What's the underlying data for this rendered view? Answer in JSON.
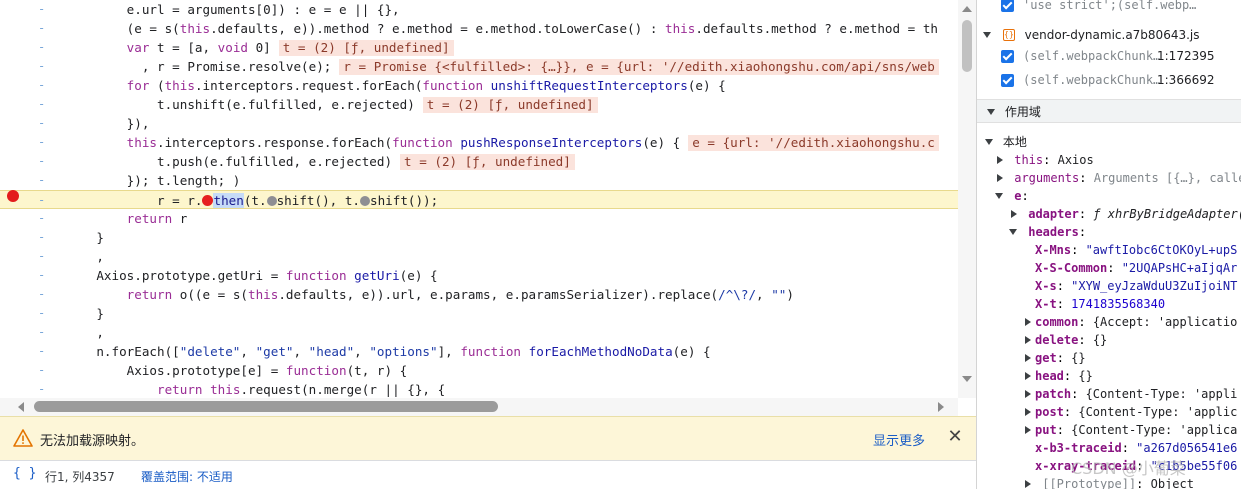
{
  "editor": {
    "lines": [
      {
        "segments": [
          {
            "t": "        e.url = arguments[0]) : e = e || {},",
            "c": ""
          }
        ]
      },
      {
        "segments": [
          {
            "t": "        (e = s(",
            "c": ""
          },
          {
            "t": "this",
            "c": "kw"
          },
          {
            "t": ".defaults, e)).method ? e.method = e.method.toLowerCase() : ",
            "c": ""
          },
          {
            "t": "this",
            "c": "kw"
          },
          {
            "t": ".defaults.method ? e.method = th",
            "c": ""
          }
        ]
      },
      {
        "segments": [
          {
            "t": "        ",
            "c": ""
          },
          {
            "t": "var",
            "c": "kw"
          },
          {
            "t": " t = [a, ",
            "c": ""
          },
          {
            "t": "void",
            "c": "kw"
          },
          {
            "t": " 0]",
            "c": ""
          }
        ],
        "value": "t = (2) [ƒ, undefined]"
      },
      {
        "segments": [
          {
            "t": "          , r = Promise.resolve(e);",
            "c": ""
          }
        ],
        "value": "r = Promise {<fulfilled>: {…}}, e = {url: '//edith.xiaohongshu.com/api/sns/web"
      },
      {
        "segments": [
          {
            "t": "        ",
            "c": ""
          },
          {
            "t": "for",
            "c": "kw"
          },
          {
            "t": " (",
            "c": ""
          },
          {
            "t": "this",
            "c": "kw"
          },
          {
            "t": ".interceptors.request.forEach(",
            "c": ""
          },
          {
            "t": "function",
            "c": "kw"
          },
          {
            "t": " ",
            "c": ""
          },
          {
            "t": "unshiftRequestInterceptors",
            "c": "fn"
          },
          {
            "t": "(e) {",
            "c": ""
          }
        ]
      },
      {
        "segments": [
          {
            "t": "            t.unshift(e.fulfilled, e.rejected)",
            "c": ""
          }
        ],
        "value": "t = (2) [ƒ, undefined]"
      },
      {
        "segments": [
          {
            "t": "        }),",
            "c": ""
          }
        ]
      },
      {
        "segments": [
          {
            "t": "        ",
            "c": ""
          },
          {
            "t": "this",
            "c": "kw"
          },
          {
            "t": ".interceptors.response.forEach(",
            "c": ""
          },
          {
            "t": "function",
            "c": "kw"
          },
          {
            "t": " ",
            "c": ""
          },
          {
            "t": "pushResponseInterceptors",
            "c": "fn"
          },
          {
            "t": "(e) {",
            "c": ""
          }
        ],
        "value": "e = {url: '//edith.xiaohongshu.c"
      },
      {
        "segments": [
          {
            "t": "            t.push(e.fulfilled, e.rejected)",
            "c": ""
          }
        ],
        "value": "t = (2) [ƒ, undefined]"
      },
      {
        "segments": [
          {
            "t": "        }); t.length; )",
            "c": ""
          }
        ]
      },
      {
        "highlight": true,
        "segments": [
          {
            "t": "            r = r.",
            "c": ""
          },
          {
            "t": "@bp",
            "c": "bp"
          },
          {
            "t": "then",
            "c": "sel"
          },
          {
            "t": "(t.",
            "c": ""
          },
          {
            "t": "@step",
            "c": "step"
          },
          {
            "t": "shift(), t.",
            "c": ""
          },
          {
            "t": "@step",
            "c": "step"
          },
          {
            "t": "shift());",
            "c": ""
          }
        ]
      },
      {
        "segments": [
          {
            "t": "        ",
            "c": ""
          },
          {
            "t": "return",
            "c": "kw"
          },
          {
            "t": " r",
            "c": ""
          }
        ]
      },
      {
        "segments": [
          {
            "t": "    }",
            "c": ""
          }
        ]
      },
      {
        "segments": [
          {
            "t": "    ,",
            "c": ""
          }
        ]
      },
      {
        "segments": [
          {
            "t": "    Axios.prototype.getUri = ",
            "c": ""
          },
          {
            "t": "function",
            "c": "kw"
          },
          {
            "t": " ",
            "c": ""
          },
          {
            "t": "getUri",
            "c": "fn"
          },
          {
            "t": "(e) {",
            "c": ""
          }
        ]
      },
      {
        "segments": [
          {
            "t": "        ",
            "c": ""
          },
          {
            "t": "return",
            "c": "kw"
          },
          {
            "t": " o((e = s(",
            "c": ""
          },
          {
            "t": "this",
            "c": "kw"
          },
          {
            "t": ".defaults, e)).url, e.params, e.paramsSerializer).replace(",
            "c": ""
          },
          {
            "t": "/^\\?/",
            "c": "str"
          },
          {
            "t": ", ",
            "c": ""
          },
          {
            "t": "\"\"",
            "c": "str"
          },
          {
            "t": ")",
            "c": ""
          }
        ]
      },
      {
        "segments": [
          {
            "t": "    }",
            "c": ""
          }
        ]
      },
      {
        "segments": [
          {
            "t": "    ,",
            "c": ""
          }
        ]
      },
      {
        "segments": [
          {
            "t": "    n.forEach([",
            "c": ""
          },
          {
            "t": "\"delete\"",
            "c": "str"
          },
          {
            "t": ", ",
            "c": ""
          },
          {
            "t": "\"get\"",
            "c": "str"
          },
          {
            "t": ", ",
            "c": ""
          },
          {
            "t": "\"head\"",
            "c": "str"
          },
          {
            "t": ", ",
            "c": ""
          },
          {
            "t": "\"options\"",
            "c": "str"
          },
          {
            "t": "], ",
            "c": ""
          },
          {
            "t": "function",
            "c": "kw"
          },
          {
            "t": " ",
            "c": ""
          },
          {
            "t": "forEachMethodNoData",
            "c": "fn"
          },
          {
            "t": "(e) {",
            "c": ""
          }
        ]
      },
      {
        "segments": [
          {
            "t": "        Axios.prototype[e] = ",
            "c": ""
          },
          {
            "t": "function",
            "c": "kw"
          },
          {
            "t": "(t, r) {",
            "c": ""
          }
        ]
      },
      {
        "segments": [
          {
            "t": "            ",
            "c": ""
          },
          {
            "t": "return",
            "c": "kw"
          },
          {
            "t": " ",
            "c": ""
          },
          {
            "t": "this",
            "c": "kw"
          },
          {
            "t": ".request(n.merge(r || {}, {",
            "c": ""
          }
        ]
      }
    ],
    "gutter_dash": "-"
  },
  "warning": {
    "text": "无法加载源映射。",
    "more": "显示更多",
    "close": "✕"
  },
  "statusbar": {
    "braces": "{ }",
    "cursor": "行1, 列4357",
    "coverage": "覆盖范围: 不适用"
  },
  "right": {
    "top_partial": "'use strict';(self.webp…",
    "file_name": "vendor-dynamic.a7b80643.js",
    "breakpoints": [
      {
        "text": "(self.webpackChunk…",
        "line": "1:172395"
      },
      {
        "text": "(self.webpackChunk…",
        "line": "1:366692"
      }
    ],
    "scope_title": "作用域",
    "local_title": "本地",
    "this_key": "this",
    "this_val": "Axios",
    "arguments_key": "arguments",
    "arguments_val": "Arguments [{…}, calle",
    "e_key": "e",
    "adapter_key": "adapter",
    "adapter_val": "ƒ xhrByBridgeAdapter(",
    "headers_key": "headers",
    "headers": [
      {
        "k": "X-Mns",
        "v": "\"awftIobc6CtOKOyL+upS"
      },
      {
        "k": "X-S-Common",
        "v": "\"2UQAPsHC+aIjqAr"
      },
      {
        "k": "X-s",
        "v": "\"XYW_eyJzaWduU3ZuIjoiNT"
      },
      {
        "k": "X-t",
        "v": "1741835568340",
        "num": true
      }
    ],
    "header_groups": [
      {
        "k": "common",
        "v": "{Accept: 'applicatio"
      },
      {
        "k": "delete",
        "v": "{}"
      },
      {
        "k": "get",
        "v": "{}"
      },
      {
        "k": "head",
        "v": "{}"
      },
      {
        "k": "patch",
        "v": "{Content-Type: 'appli"
      },
      {
        "k": "post",
        "v": "{Content-Type: 'applic"
      },
      {
        "k": "put",
        "v": "{Content-Type: 'applica"
      }
    ],
    "trace_headers": [
      {
        "k": "x-b3-traceid",
        "v": "\"a267d056541e6"
      },
      {
        "k": "x-xray-traceid",
        "v": "\"c1b5be55f06"
      }
    ],
    "prototype_key": "[[Prototype]]",
    "prototype_val": "Object"
  },
  "watermark": "CSDN @小葡菜"
}
